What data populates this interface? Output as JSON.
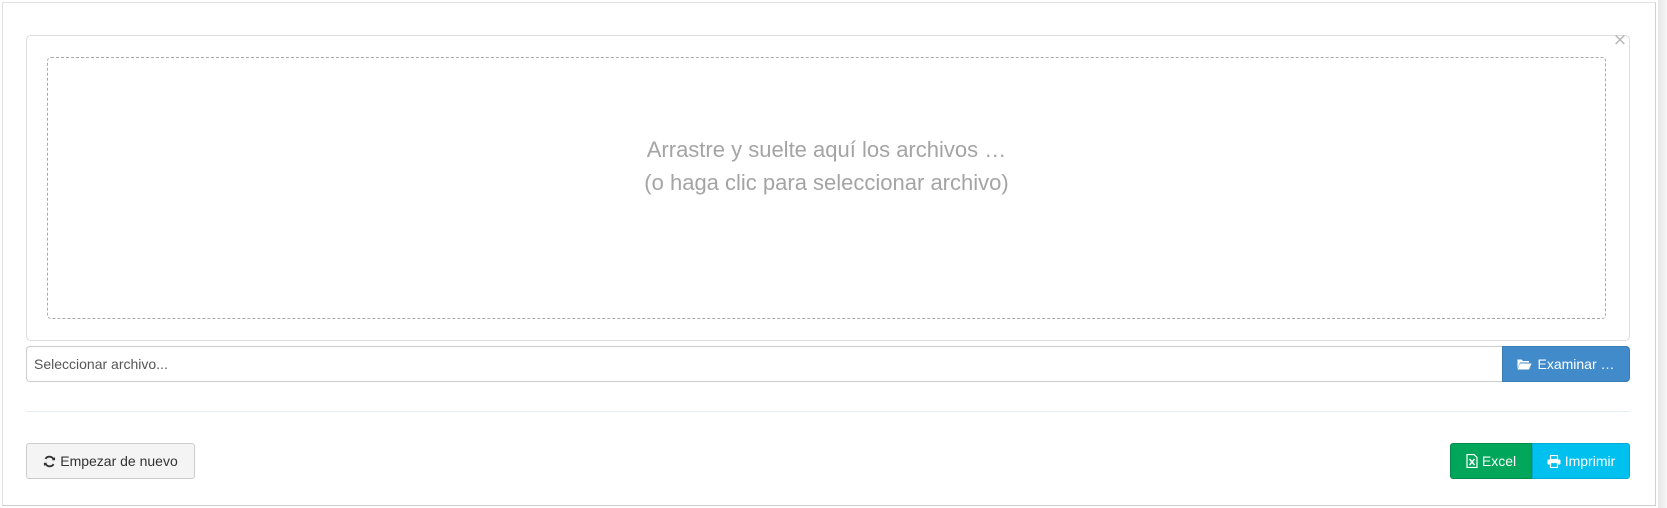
{
  "preview": {
    "drop_line1": "Arrastre y suelte aquí los archivos …",
    "drop_line2": "(o haga clic para seleccionar archivo)",
    "close_symbol": "×"
  },
  "file_input": {
    "caption": "Seleccionar archivo...",
    "browse_label": "Examinar …",
    "browse_icon": "folder-open-icon",
    "browse_color": "#428bca"
  },
  "actions": {
    "restart_label": "Empezar de nuevo",
    "restart_icon": "refresh-icon",
    "excel_label": "Excel",
    "excel_icon": "file-excel-icon",
    "excel_color": "#00a65a",
    "print_label": "Imprimir",
    "print_icon": "print-icon",
    "print_color": "#00c0ef"
  }
}
